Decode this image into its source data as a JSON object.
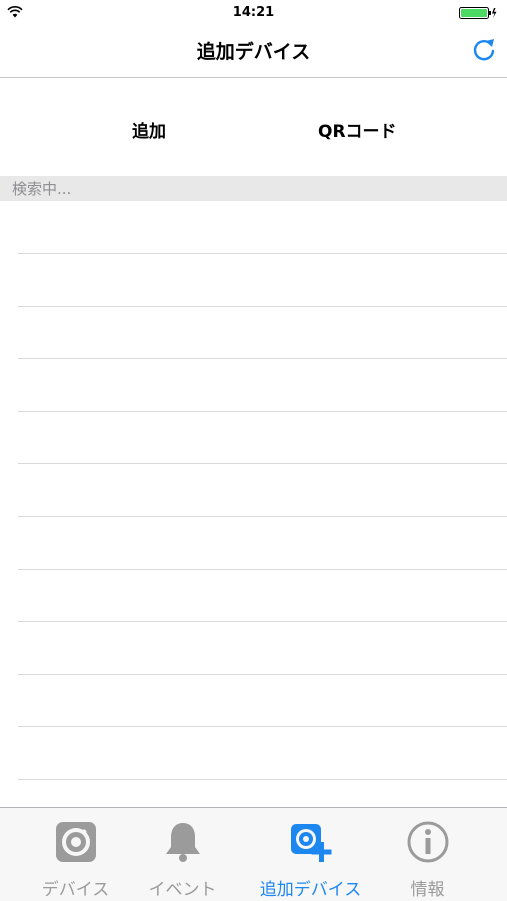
{
  "status_bar": {
    "time": "14:21"
  },
  "nav": {
    "title": "追加デバイス"
  },
  "actions": {
    "add_label": "追加",
    "qr_label": "QRコード"
  },
  "section": {
    "label": "検索中..."
  },
  "device_list": {
    "rows": [
      "",
      "",
      "",
      "",
      "",
      "",
      "",
      "",
      "",
      "",
      ""
    ]
  },
  "tabs": [
    {
      "label": "デバイス",
      "icon": "device-icon",
      "active": false
    },
    {
      "label": "イベント",
      "icon": "bell-icon",
      "active": false
    },
    {
      "label": "追加デバイス",
      "icon": "add-device-icon",
      "active": true
    },
    {
      "label": "情報",
      "icon": "info-icon",
      "active": false
    }
  ],
  "colors": {
    "accent": "#1d87f0",
    "inactive": "#9b9b9b",
    "battery": "#4cd964",
    "separator": "#d9d9dc",
    "section_bg": "#e8e8e8"
  }
}
